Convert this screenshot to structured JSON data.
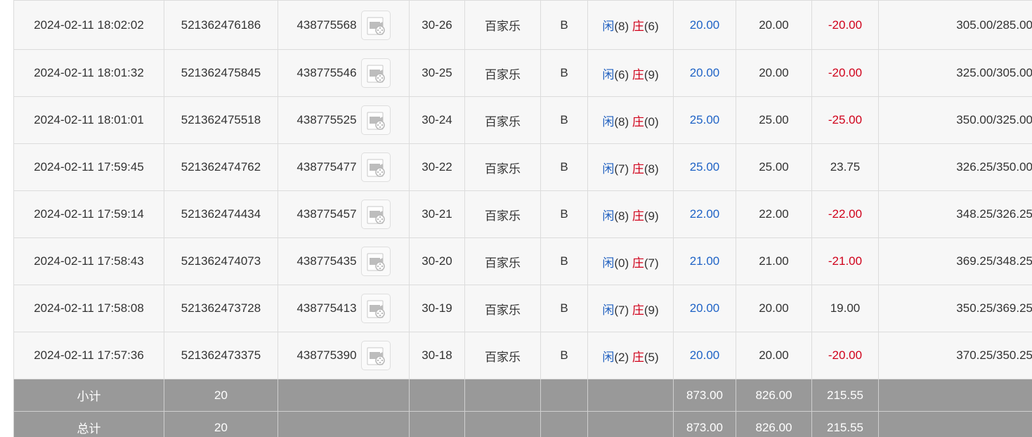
{
  "rows": [
    {
      "time": "2024-02-11 18:02:02",
      "bet_id": "521362476186",
      "round_id": "438775568",
      "table": "30-26",
      "game": "百家乐",
      "side": "B",
      "player_label": "闲",
      "player_score": "(8)",
      "banker_label": "庄",
      "banker_score": "(6)",
      "bet": "20.00",
      "valid": "20.00",
      "winloss": "-20.00",
      "winloss_color": "red",
      "balance": "305.00/285.00"
    },
    {
      "time": "2024-02-11 18:01:32",
      "bet_id": "521362475845",
      "round_id": "438775546",
      "table": "30-25",
      "game": "百家乐",
      "side": "B",
      "player_label": "闲",
      "player_score": "(6)",
      "banker_label": "庄",
      "banker_score": "(9)",
      "bet": "20.00",
      "valid": "20.00",
      "winloss": "-20.00",
      "winloss_color": "red",
      "balance": "325.00/305.00"
    },
    {
      "time": "2024-02-11 18:01:01",
      "bet_id": "521362475518",
      "round_id": "438775525",
      "table": "30-24",
      "game": "百家乐",
      "side": "B",
      "player_label": "闲",
      "player_score": "(8)",
      "banker_label": "庄",
      "banker_score": "(0)",
      "bet": "25.00",
      "valid": "25.00",
      "winloss": "-25.00",
      "winloss_color": "red",
      "balance": "350.00/325.00"
    },
    {
      "time": "2024-02-11 17:59:45",
      "bet_id": "521362474762",
      "round_id": "438775477",
      "table": "30-22",
      "game": "百家乐",
      "side": "B",
      "player_label": "闲",
      "player_score": "(7)",
      "banker_label": "庄",
      "banker_score": "(8)",
      "bet": "25.00",
      "valid": "25.00",
      "winloss": "23.75",
      "winloss_color": "normal",
      "balance": "326.25/350.00"
    },
    {
      "time": "2024-02-11 17:59:14",
      "bet_id": "521362474434",
      "round_id": "438775457",
      "table": "30-21",
      "game": "百家乐",
      "side": "B",
      "player_label": "闲",
      "player_score": "(8)",
      "banker_label": "庄",
      "banker_score": "(9)",
      "bet": "22.00",
      "valid": "22.00",
      "winloss": "-22.00",
      "winloss_color": "red",
      "balance": "348.25/326.25"
    },
    {
      "time": "2024-02-11 17:58:43",
      "bet_id": "521362474073",
      "round_id": "438775435",
      "table": "30-20",
      "game": "百家乐",
      "side": "B",
      "player_label": "闲",
      "player_score": "(0)",
      "banker_label": "庄",
      "banker_score": "(7)",
      "bet": "21.00",
      "valid": "21.00",
      "winloss": "-21.00",
      "winloss_color": "red",
      "balance": "369.25/348.25"
    },
    {
      "time": "2024-02-11 17:58:08",
      "bet_id": "521362473728",
      "round_id": "438775413",
      "table": "30-19",
      "game": "百家乐",
      "side": "B",
      "player_label": "闲",
      "player_score": "(7)",
      "banker_label": "庄",
      "banker_score": "(9)",
      "bet": "20.00",
      "valid": "20.00",
      "winloss": "19.00",
      "winloss_color": "normal",
      "balance": "350.25/369.25"
    },
    {
      "time": "2024-02-11 17:57:36",
      "bet_id": "521362473375",
      "round_id": "438775390",
      "table": "30-18",
      "game": "百家乐",
      "side": "B",
      "player_label": "闲",
      "player_score": "(2)",
      "banker_label": "庄",
      "banker_score": "(5)",
      "bet": "20.00",
      "valid": "20.00",
      "winloss": "-20.00",
      "winloss_color": "red",
      "balance": "370.25/350.25"
    }
  ],
  "subtotal": {
    "label": "小计",
    "count": "20",
    "bet": "873.00",
    "valid": "826.00",
    "winloss": "215.55"
  },
  "total": {
    "label": "总计",
    "count": "20",
    "bet": "873.00",
    "valid": "826.00",
    "winloss": "215.55"
  },
  "icons": {
    "replay": "film-replay-icon"
  },
  "colors": {
    "player": "#1f5fbf",
    "banker": "#d0021b",
    "bet_amount": "#1f63c6",
    "loss": "#d0021b",
    "summary_bg": "#999999"
  }
}
